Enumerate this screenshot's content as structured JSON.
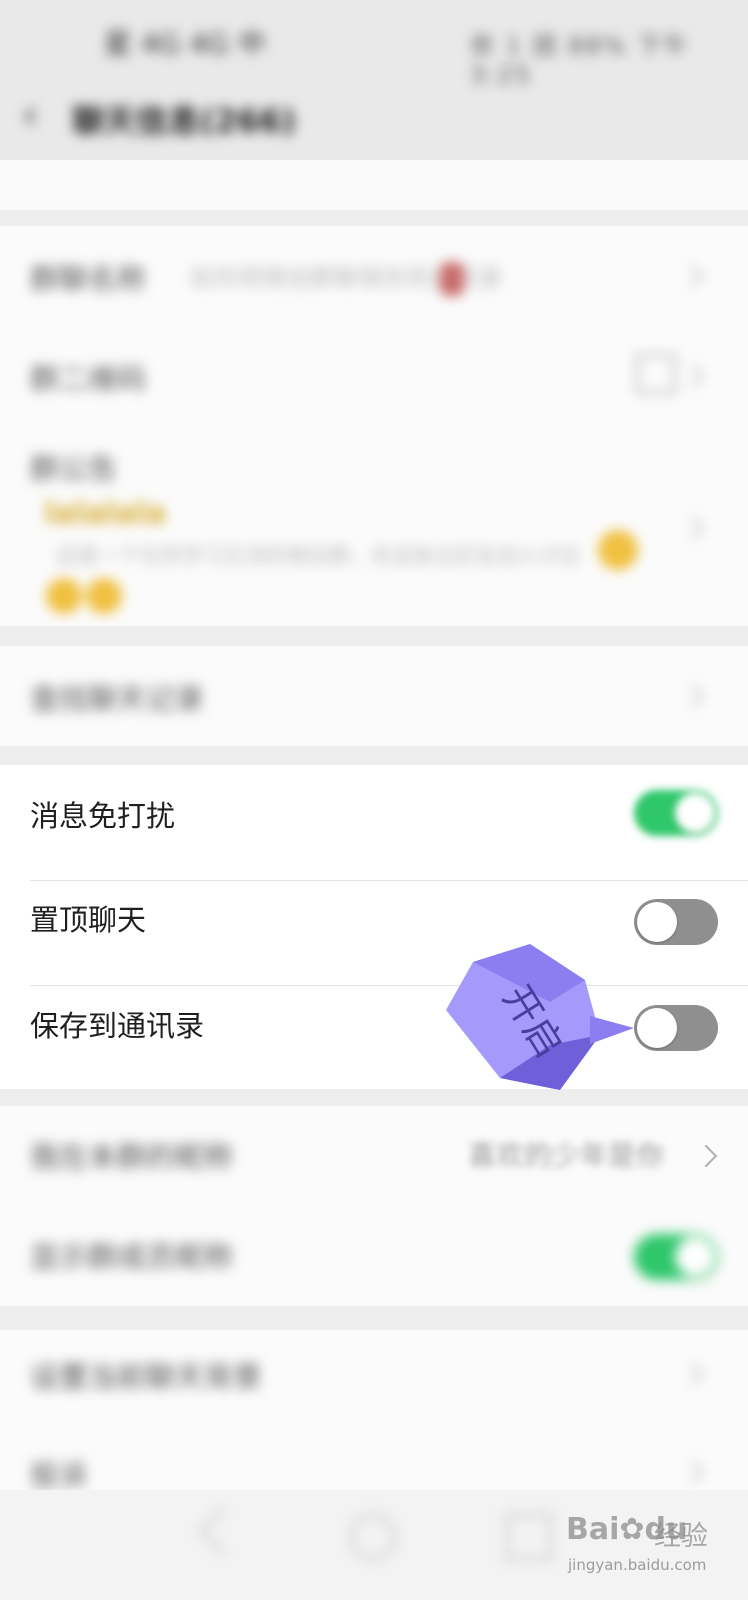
{
  "status_bar": {
    "left": "星 4G 4G 中",
    "right": "奈 1 团 88% 下午3:25"
  },
  "nav": {
    "back": "‹",
    "title": "聊天信息(266)"
  },
  "blurred_group": {
    "group_name_label": "群聊名称",
    "group_name_value": "如何将微信群聊保存到通讯录",
    "qr_label": "群二维码",
    "notice_label": "群公告",
    "notice_title": "lalalala",
    "notice_body": "这是一个仅供学习交流的微信群，欢迎各位好友加入讨论",
    "search_label": "查找聊天记录"
  },
  "settings": {
    "mute_label": "消息免打扰",
    "mute_on": true,
    "pin_label": "置顶聊天",
    "pin_on": false,
    "save_label": "保存到通讯录",
    "save_on": false
  },
  "lower": {
    "nickname_label": "我在本群的昵称",
    "nickname_value": "喜欢的少年是你",
    "show_names_label": "显示群成员昵称",
    "show_names_on": true,
    "background_label": "设置当前聊天背景",
    "report_label": "投诉"
  },
  "annotation": {
    "text": "开启",
    "color": "#a59afb"
  },
  "watermark": {
    "logo": "Bai",
    "logo2": "du",
    "cn": "经验",
    "url": "jingyan.baidu.com"
  },
  "colors": {
    "toggle_on": "#2ec76a",
    "toggle_off": "#8f8f8f",
    "background": "#ededed"
  }
}
